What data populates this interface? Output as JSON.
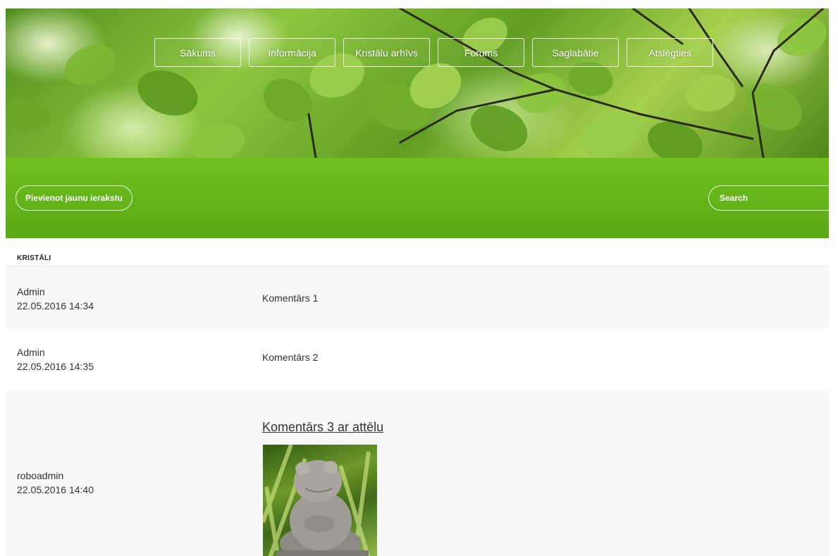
{
  "nav": {
    "items": [
      "Sākums",
      "Informācija",
      "Kristālu arhīvs",
      "Forums",
      "Saglabātie",
      "Atslēgties"
    ]
  },
  "toolbar": {
    "add_label": "Pievienot jaunu ierakstu",
    "search_placeholder": "Search"
  },
  "section": {
    "title": "KRISTĀLI"
  },
  "comments": [
    {
      "author": "Admin",
      "date": "22.05.2016 14:34",
      "text": "Komentārs 1"
    },
    {
      "author": "Admin",
      "date": "22.05.2016 14:35",
      "text": "Komentārs 2"
    },
    {
      "author": "roboadmin",
      "date": "22.05.2016 14:40",
      "text": "Komentārs 3 ar attēlu"
    }
  ],
  "colors": {
    "toolbar_green": "#62b31a",
    "row_alt": "#f8f8f8",
    "text": "#333333"
  }
}
